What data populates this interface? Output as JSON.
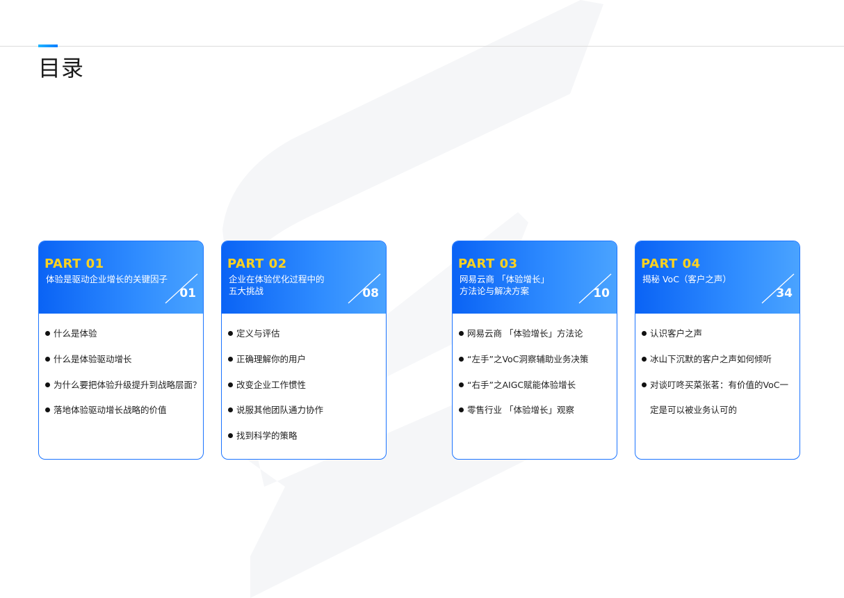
{
  "page": {
    "title": "目录"
  },
  "colors": {
    "accent": "#1a73ff",
    "part_label": "#ffd21f",
    "header_gradient_start": "#0a63f5",
    "header_gradient_end": "#4aa3ff"
  },
  "parts": [
    {
      "label": "PART 01",
      "title": "体验是驱动企业增长的关键因子",
      "page": "01",
      "items": [
        "什么是体验",
        "什么是体验驱动增长",
        "为什么要把体验升级提升到战略层面？",
        "落地体验驱动增长战略的价值"
      ]
    },
    {
      "label": "PART 02",
      "title_line1": "企业在体验优化过程中的",
      "title_line2": "五大挑战",
      "page": "08",
      "items": [
        "定义与评估",
        "正确理解你的用户",
        "改变企业工作惯性",
        "说服其他团队通力协作",
        "找到科学的策略"
      ]
    },
    {
      "label": "PART 03",
      "title_line1": "网易云商 「体验增长」",
      "title_line2": "方法论与解决方案",
      "page": "10",
      "items": [
        "网易云商 「体验增长」方法论",
        "“左手”之VoC洞察辅助业务决策",
        "“右手”之AIGC赋能体验增长",
        "零售行业 「体验增长」观察"
      ]
    },
    {
      "label": "PART 04",
      "title": "揭秘 VoC（客户之声）",
      "page": "34",
      "items": [
        "认识客户之声",
        "冰山下沉默的客户之声如何倾听",
        "对谈叮咚买菜张茗：有价值的VoC一"
      ],
      "item_continuation": "定是可以被业务认可的"
    }
  ]
}
